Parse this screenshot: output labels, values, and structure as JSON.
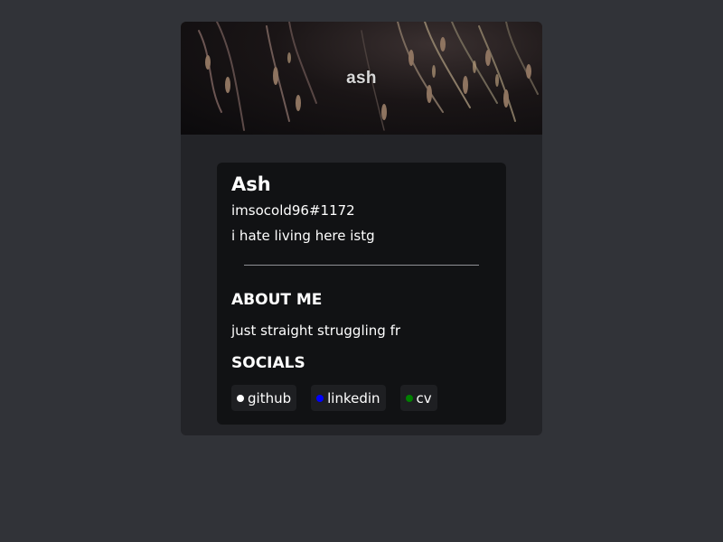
{
  "banner": {
    "title": "ash"
  },
  "profile": {
    "display_name": "Ash",
    "username": "imsocold96#1172",
    "status": "i hate living here istg"
  },
  "about": {
    "title": "ABOUT ME",
    "text": "just straight struggling fr"
  },
  "socials": {
    "title": "SOCIALS",
    "items": [
      {
        "label": "github",
        "dot_color": "#ffffff"
      },
      {
        "label": "linkedin",
        "dot_color": "#0000ff"
      },
      {
        "label": "cv",
        "dot_color": "#008000"
      }
    ]
  },
  "colors": {
    "page_bg": "#313338",
    "card_bg": "#232428",
    "inner_bg": "#111214",
    "chip_bg": "#1e1f22"
  }
}
